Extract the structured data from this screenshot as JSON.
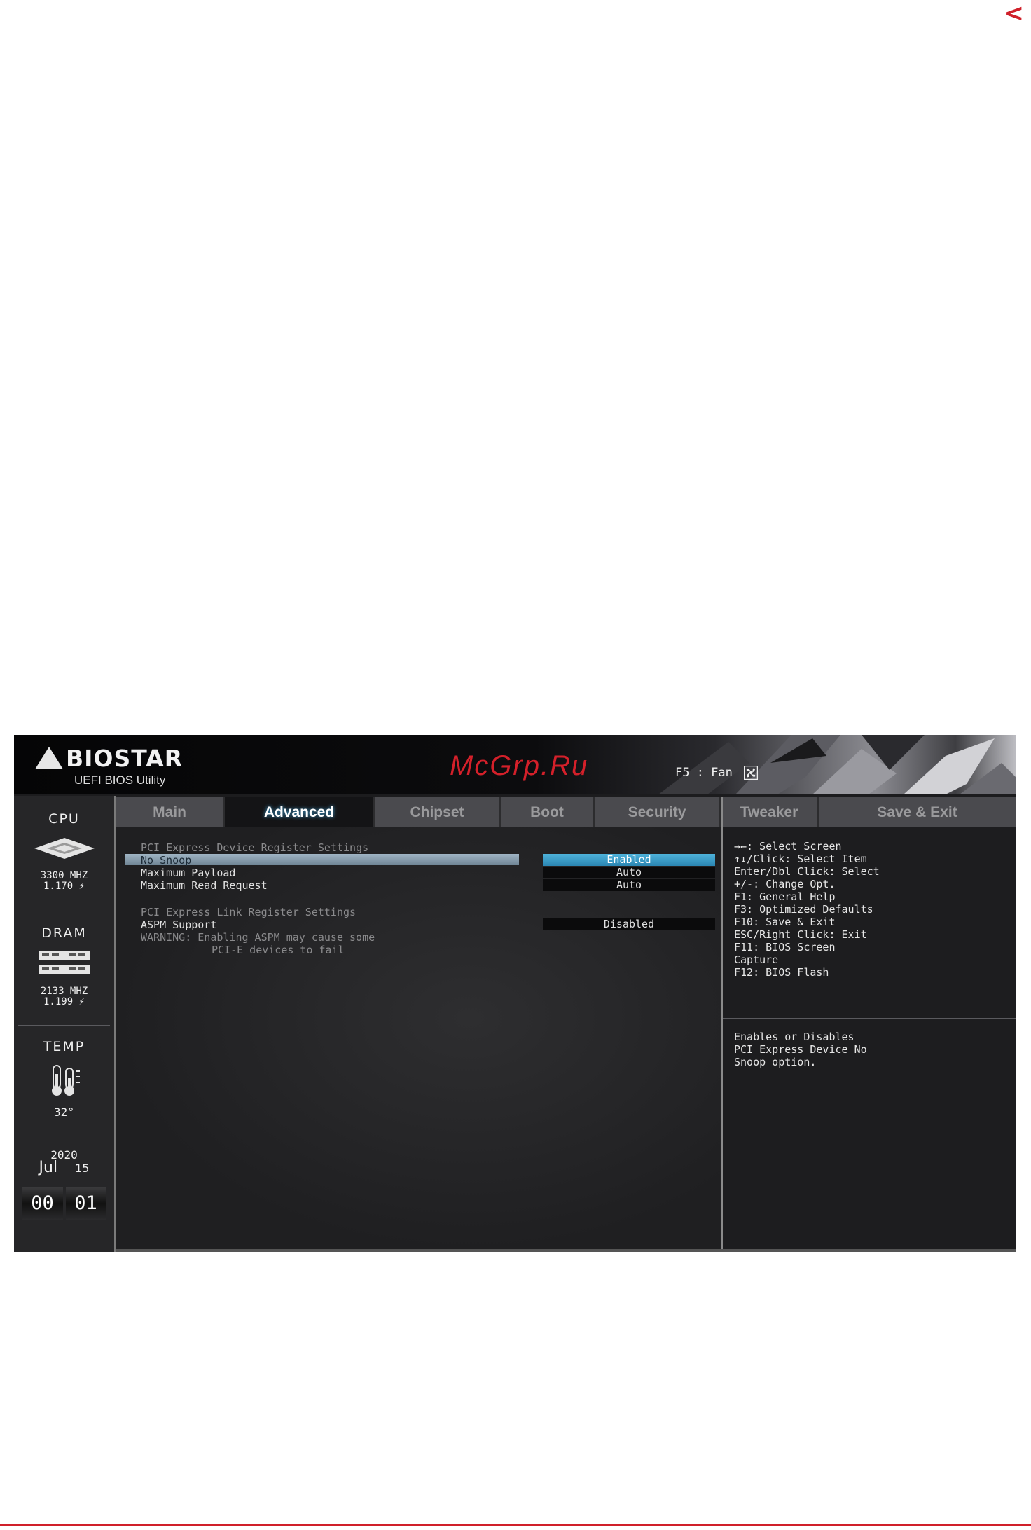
{
  "back_arrow": "<",
  "header": {
    "brand": "BIOSTAR",
    "subtitle": "UEFI BIOS Utility",
    "watermark": "McGrp.Ru",
    "f5_label": "F5 : Fan"
  },
  "sidebar": {
    "cpu": {
      "title": "CPU",
      "freq": "3300 MHZ",
      "volt": "1.170 ⚡"
    },
    "dram": {
      "title": "DRAM",
      "freq": "2133 MHZ",
      "volt": "1.199 ⚡"
    },
    "temp": {
      "title": "TEMP",
      "value": "32°"
    },
    "date": {
      "year": "2020",
      "month": "Jul",
      "day": "15"
    },
    "time": {
      "hours": "00",
      "minutes": "01"
    }
  },
  "tabs": [
    {
      "label": "Main"
    },
    {
      "label": "Advanced"
    },
    {
      "label": "Chipset"
    },
    {
      "label": "Boot"
    },
    {
      "label": "Security"
    },
    {
      "label": "Tweaker"
    },
    {
      "label": "Save & Exit"
    }
  ],
  "active_tab": "Advanced",
  "settings": {
    "device_heading": "PCI Express Device Register Settings",
    "no_snoop": {
      "label": "No Snoop",
      "value": "Enabled"
    },
    "max_payload": {
      "label": "Maximum Payload",
      "value": "Auto"
    },
    "max_read": {
      "label": "Maximum Read Request",
      "value": "Auto"
    },
    "link_heading": "PCI Express Link Register Settings",
    "aspm": {
      "label": "ASPM Support",
      "value": "Disabled"
    },
    "warning_1": "WARNING: Enabling ASPM may cause some",
    "warning_2": "PCI-E devices to fail"
  },
  "help": {
    "keys": [
      "→←: Select Screen",
      "↑↓/Click: Select Item",
      "Enter/Dbl Click: Select",
      "+/-: Change Opt.",
      "F1: General Help",
      "F3: Optimized Defaults",
      "F10: Save & Exit",
      "ESC/Right Click: Exit",
      "F11: BIOS Screen",
      "Capture",
      "F12: BIOS Flash"
    ],
    "description": [
      "Enables or Disables",
      "PCI Express Device No",
      "Snoop option."
    ]
  }
}
